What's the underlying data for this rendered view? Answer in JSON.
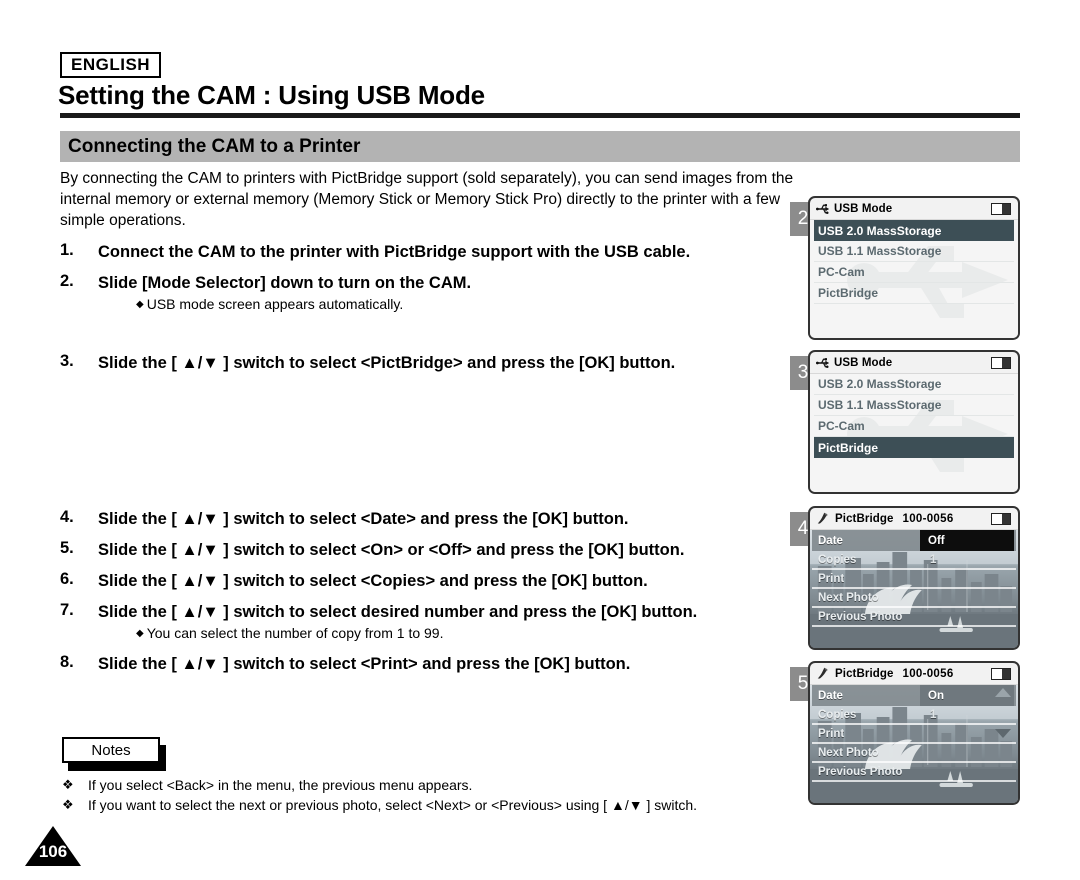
{
  "header": {
    "language": "ENGLISH",
    "title": "Setting the CAM : Using USB Mode",
    "section": "Connecting the CAM to a Printer"
  },
  "intro": "By connecting the CAM to printers with PictBridge support (sold separately), you can send images from the internal memory or external memory (Memory Stick or Memory Stick Pro) directly to the printer with a few simple operations.",
  "steps": [
    {
      "num": "1.",
      "text": "Connect the CAM to the printer with PictBridge support with the USB cable."
    },
    {
      "num": "2.",
      "text": "Slide [Mode Selector] down to turn on the CAM.",
      "note": "USB mode screen appears automatically."
    },
    {
      "num": "3.",
      "text": "Slide the [ ▲/▼ ] switch to select <PictBridge> and press the [OK] button."
    },
    {
      "num": "4.",
      "text": "Slide the [ ▲/▼ ] switch to select <Date> and press the [OK] button."
    },
    {
      "num": "5.",
      "text": "Slide the [ ▲/▼ ] switch to select <On> or <Off> and press the [OK] button."
    },
    {
      "num": "6.",
      "text": "Slide the [ ▲/▼ ] switch to select <Copies> and press the [OK] button."
    },
    {
      "num": "7.",
      "text": "Slide the [ ▲/▼ ] switch to select desired number and press the [OK] button.",
      "note": "You can select the number of copy from 1 to 99."
    },
    {
      "num": "8.",
      "text": "Slide the [ ▲/▼ ] switch to select <Print> and press the [OK] button."
    }
  ],
  "notes": {
    "tab_label": "Notes",
    "bullet": "❖",
    "items": [
      "If you select <Back> in the menu, the previous menu appears.",
      "If you want to select the next or previous photo, select <Next> or <Previous> using [ ▲/▼ ] switch."
    ]
  },
  "page_number": "106",
  "screens": [
    {
      "step": "2",
      "type": "usb-mode",
      "icon": "usb-icon",
      "title": "USB Mode",
      "battery_icon": "battery-icon",
      "items": [
        {
          "label": "USB 2.0 MassStorage",
          "selected": true
        },
        {
          "label": "USB 1.1 MassStorage",
          "selected": false
        },
        {
          "label": "PC-Cam",
          "selected": false
        },
        {
          "label": "PictBridge",
          "selected": false
        }
      ]
    },
    {
      "step": "3",
      "type": "usb-mode",
      "icon": "usb-icon",
      "title": "USB Mode",
      "battery_icon": "battery-icon",
      "items": [
        {
          "label": "USB 2.0 MassStorage",
          "selected": false
        },
        {
          "label": "USB 1.1 MassStorage",
          "selected": false
        },
        {
          "label": "PC-Cam",
          "selected": false
        },
        {
          "label": "PictBridge",
          "selected": true
        }
      ]
    },
    {
      "step": "4",
      "type": "pictbridge",
      "icon": "pictbridge-icon",
      "title": "PictBridge",
      "file_number": "100-0056",
      "battery_icon": "battery-icon",
      "show_arrows": false,
      "items": [
        {
          "label": "Date",
          "value": "Off",
          "highlight": true
        },
        {
          "label": "Copies",
          "value": "1"
        },
        {
          "label": "Print"
        },
        {
          "label": "Next Photo"
        },
        {
          "label": "Previous Photo"
        }
      ]
    },
    {
      "step": "5",
      "type": "pictbridge",
      "icon": "pictbridge-icon",
      "title": "PictBridge",
      "file_number": "100-0056",
      "battery_icon": "battery-icon",
      "show_arrows": true,
      "items": [
        {
          "label": "Date",
          "value": "On",
          "highlight": true
        },
        {
          "label": "Copies",
          "value": "1"
        },
        {
          "label": "Print"
        },
        {
          "label": "Next Photo"
        },
        {
          "label": "Previous Photo"
        }
      ]
    }
  ]
}
